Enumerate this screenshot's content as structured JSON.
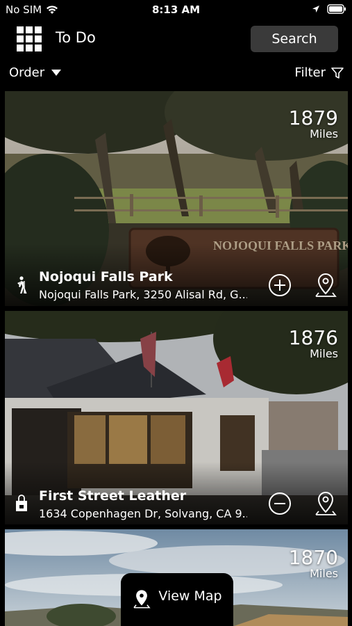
{
  "status_bar": {
    "carrier": "No SIM",
    "time": "8:13 AM"
  },
  "header": {
    "title": "To Do",
    "search_label": "Search"
  },
  "toolbar": {
    "order_label": "Order",
    "filter_label": "Filter"
  },
  "cards": [
    {
      "name": "Nojoqui Falls Park",
      "address": "Nojoqui Falls Park, 3250 Alisal Rd, G...",
      "distance": "1879",
      "unit": "Miles",
      "category_icon": "hiker-icon",
      "action_icon": "add-icon",
      "sign_text": "NOJOQUI FALLS PARK"
    },
    {
      "name": "First Street Leather",
      "address": "1634 Copenhagen Dr, Solvang, CA 9...",
      "distance": "1876",
      "unit": "Miles",
      "category_icon": "shopping-bag-icon",
      "action_icon": "remove-icon"
    },
    {
      "distance": "1870",
      "unit": "Miles"
    }
  ],
  "view_map_label": "View Map"
}
